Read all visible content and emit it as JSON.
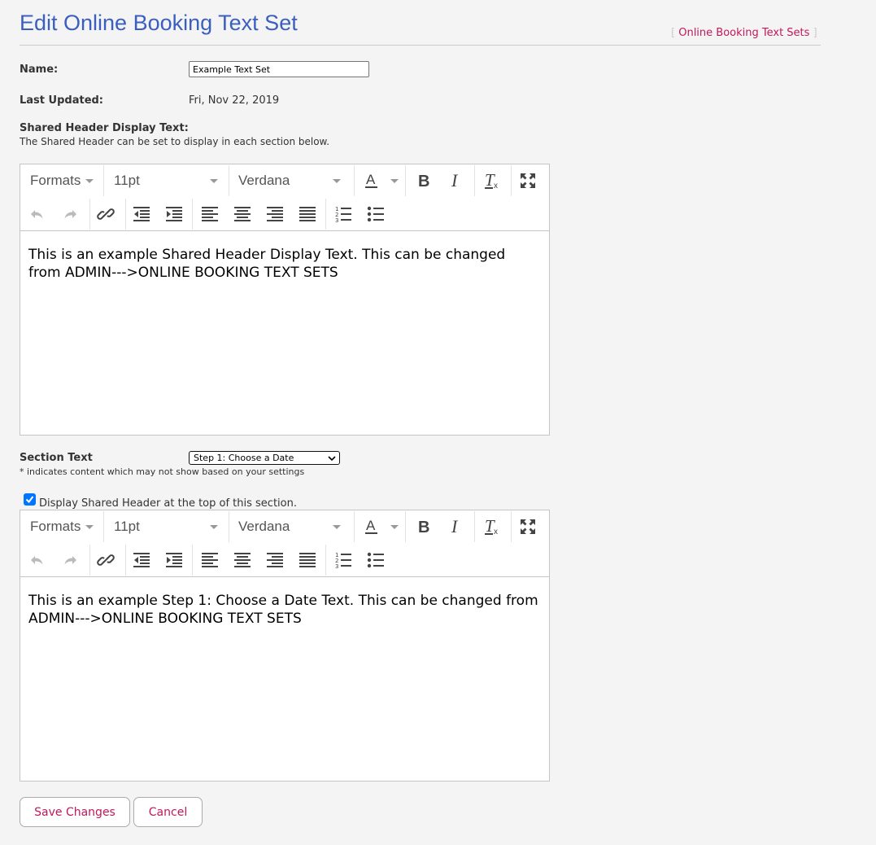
{
  "page": {
    "title": "Edit Online Booking Text Set",
    "back_link": {
      "bracket_open": "[",
      "label": "Online Booking Text Sets",
      "bracket_close": "]"
    }
  },
  "form": {
    "name_label": "Name:",
    "name_value": "Example Text Set",
    "last_updated_label": "Last Updated:",
    "last_updated_value": "Fri, Nov 22, 2019",
    "shared_header_label": "Shared Header Display Text:",
    "shared_header_help": "The Shared Header can be set to display in each section below.",
    "section_text_label": "Section Text",
    "section_select_value": "Step 1: Choose a Date",
    "section_note": "* indicates content which may not show based on your settings",
    "display_shared_header_label": "Display Shared Header at the top of this section.",
    "display_shared_header_checked": true
  },
  "toolbar": {
    "formats_label": "Formats",
    "size_label": "11pt",
    "font_label": "Verdana",
    "icons": [
      "font-color-icon",
      "bold-icon",
      "italic-icon",
      "clear-formatting-icon",
      "fullscreen-icon",
      "undo-icon",
      "redo-icon",
      "link-icon",
      "outdent-icon",
      "indent-icon",
      "align-left-icon",
      "align-center-icon",
      "align-right-icon",
      "align-justify-icon",
      "numbered-list-icon",
      "bullet-list-icon"
    ]
  },
  "editors": {
    "shared_header_text": "This is an example Shared Header Display Text. This can be changed from ADMIN--->ONLINE BOOKING TEXT SETS",
    "section_text": "This is an example Step 1: Choose a Date Text. This can be changed from ADMIN--->ONLINE BOOKING TEXT SETS"
  },
  "actions": {
    "save_label": "Save Changes",
    "cancel_label": "Cancel"
  },
  "colors": {
    "title": "#3b5fc0",
    "link": "#c0185a",
    "checkbox": "#0075ff",
    "background": "#f4f4f4"
  }
}
